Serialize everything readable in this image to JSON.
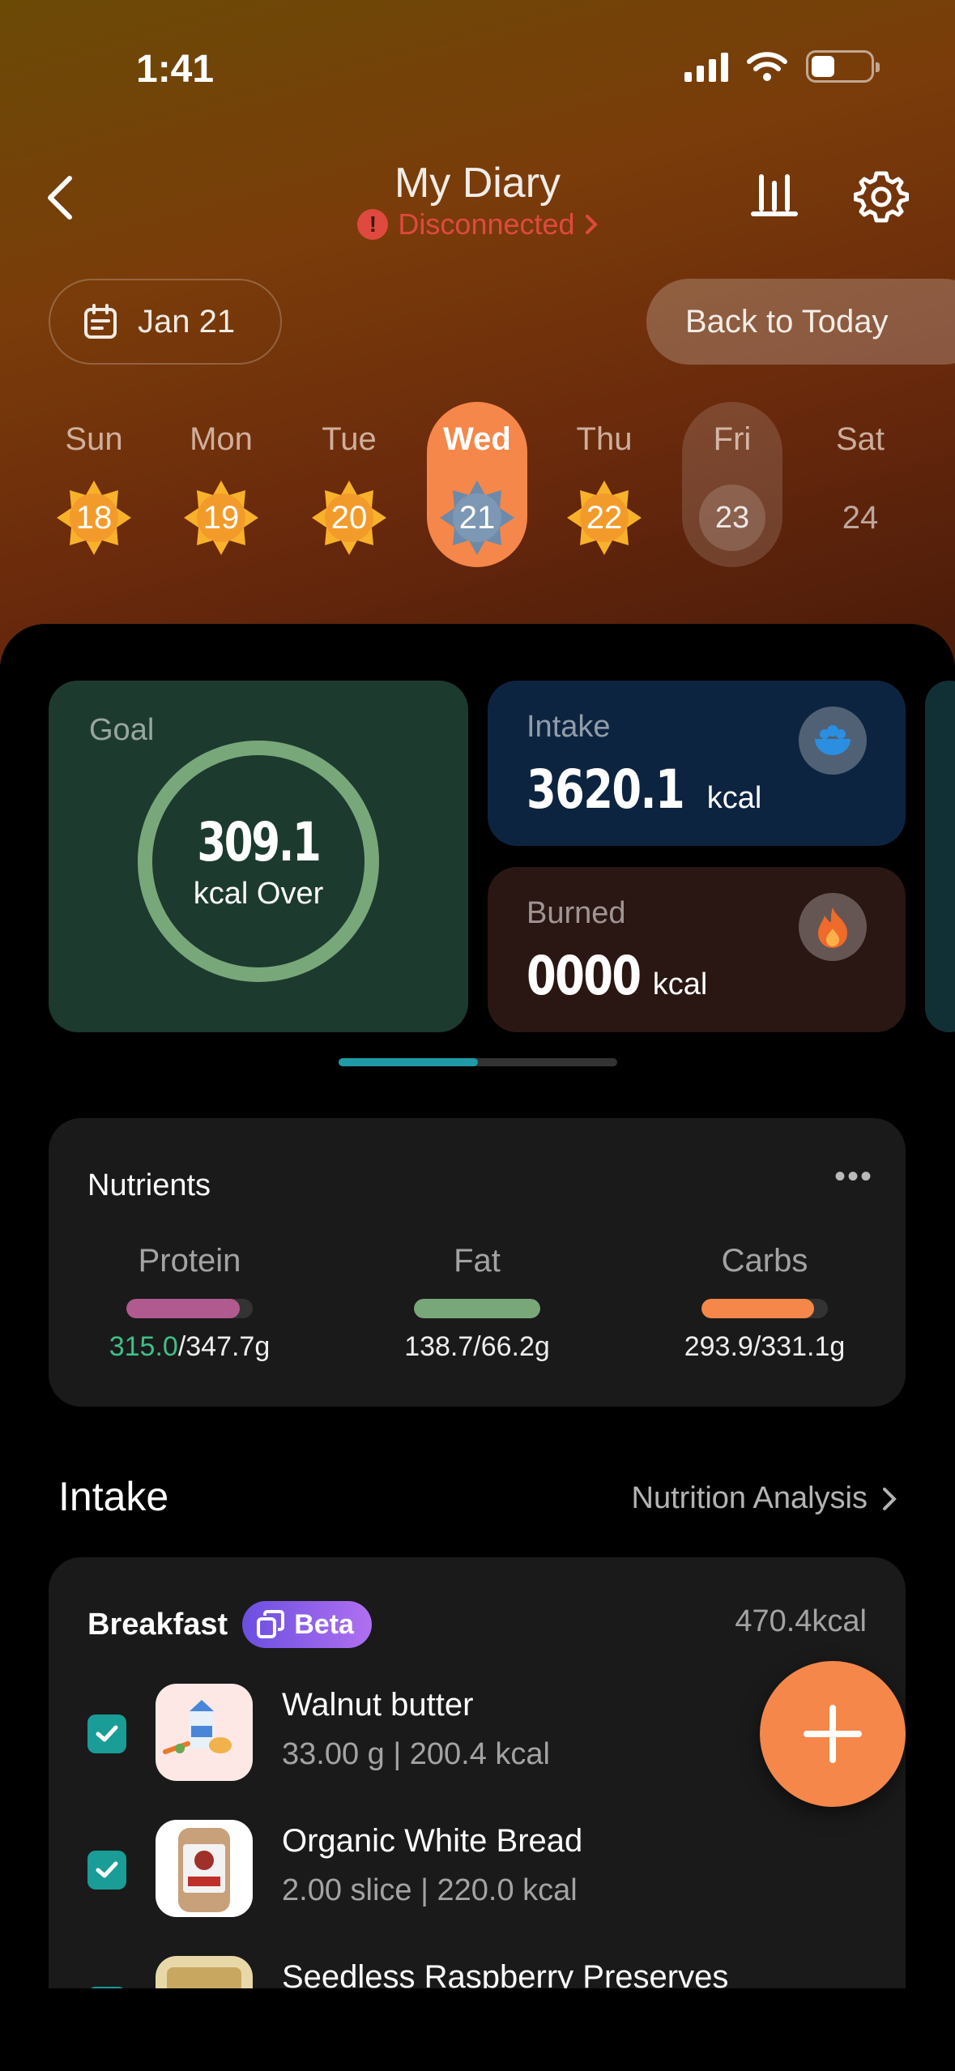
{
  "status_bar": {
    "time": "1:41"
  },
  "header": {
    "title": "My Diary",
    "connection_status": "Disconnected"
  },
  "date_selector": {
    "date_label": "Jan 21",
    "back_to_today_label": "Back to Today"
  },
  "week": [
    {
      "name": "Sun",
      "num": "18",
      "state": "past"
    },
    {
      "name": "Mon",
      "num": "19",
      "state": "past"
    },
    {
      "name": "Tue",
      "num": "20",
      "state": "past"
    },
    {
      "name": "Wed",
      "num": "21",
      "state": "selected"
    },
    {
      "name": "Thu",
      "num": "22",
      "state": "past"
    },
    {
      "name": "Fri",
      "num": "23",
      "state": "today"
    },
    {
      "name": "Sat",
      "num": "24",
      "state": "future"
    }
  ],
  "summary": {
    "goal": {
      "label": "Goal",
      "value": "309.1",
      "sub": "kcal Over"
    },
    "intake": {
      "label": "Intake",
      "value": "3620.1",
      "unit": "kcal"
    },
    "burned": {
      "label": "Burned",
      "value": "0000",
      "unit": "kcal"
    },
    "pager_progress": 0.5
  },
  "nutrients": {
    "title": "Nutrients",
    "items": [
      {
        "name": "Protein",
        "consumed": "315.0",
        "target": "/347.7g",
        "fill": 0.9,
        "color": "#b15a8f"
      },
      {
        "name": "Fat",
        "consumed": "",
        "target": "138.7/66.2g",
        "fill": 1.0,
        "color": "#78a87a"
      },
      {
        "name": "Carbs",
        "consumed": "",
        "target": "293.9/331.1g",
        "fill": 0.89,
        "color": "#f5874a"
      }
    ]
  },
  "intake_section": {
    "title": "Intake",
    "link_label": "Nutrition Analysis"
  },
  "meal": {
    "name": "Breakfast",
    "badge": "Beta",
    "kcal": "470.4kcal",
    "foods": [
      {
        "name": "Walnut butter",
        "detail": "33.00 g | 200.4 kcal"
      },
      {
        "name": "Organic White Bread",
        "detail": "2.00 slice | 220.0 kcal"
      },
      {
        "name": "Seedless Raspberry Preserves",
        "detail": ""
      }
    ]
  },
  "colors": {
    "accent": "#f5874a",
    "goal_card": "#1d3a2e",
    "intake_card": "#0d2440",
    "burned_card": "#2a1612",
    "teal": "#1a9c97"
  }
}
